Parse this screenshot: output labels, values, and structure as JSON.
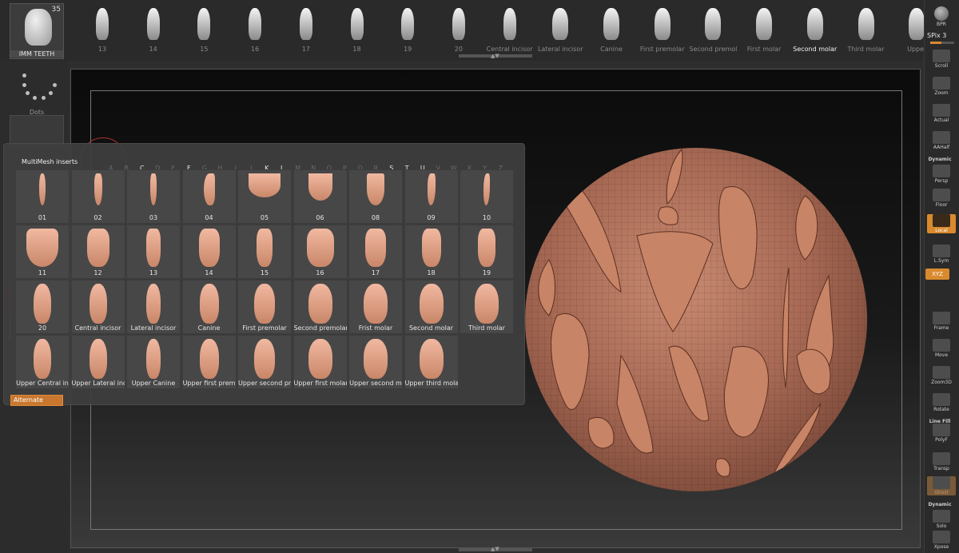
{
  "top_shelf": {
    "active_tile": {
      "label": "IMM TEETH",
      "count": "35"
    },
    "items": [
      {
        "label": "13"
      },
      {
        "label": "14"
      },
      {
        "label": "15"
      },
      {
        "label": "16"
      },
      {
        "label": "17"
      },
      {
        "label": "18"
      },
      {
        "label": "19"
      },
      {
        "label": "20"
      },
      {
        "label": "Central incisor"
      },
      {
        "label": "Lateral incisor"
      },
      {
        "label": "Canine"
      },
      {
        "label": "First premolar"
      },
      {
        "label": "Second premolar"
      },
      {
        "label": "First molar"
      },
      {
        "label": "Second molar"
      },
      {
        "label": "Third molar"
      },
      {
        "label": "Upper"
      }
    ],
    "selected_label": "Second molar"
  },
  "left_tray": {
    "dots_label": "Dots"
  },
  "multimesh": {
    "title": "MultiMesh inserts",
    "letters": [
      "A",
      "B",
      "C",
      "D",
      "E",
      "F",
      "G",
      "H",
      "I",
      "J",
      "K",
      "L",
      "M",
      "N",
      "O",
      "P",
      "Q",
      "R",
      "S",
      "T",
      "U",
      "V",
      "W",
      "X",
      "Y",
      "Z"
    ],
    "active_letters": [
      "C",
      "F",
      "K",
      "L",
      "S",
      "T",
      "U"
    ],
    "items": [
      "01",
      "02",
      "03",
      "04",
      "05",
      "06",
      "08",
      "09",
      "10",
      "11",
      "12",
      "13",
      "14",
      "15",
      "16",
      "17",
      "18",
      "19",
      "20",
      "Central incisor",
      "Lateral incisor",
      "Canine",
      "First premolar",
      "Second premolar",
      "Frist molar",
      "Second molar",
      "Third molar",
      "Upper Central in",
      "Upper Lateral inc",
      "Upper Canine",
      "Upper first prem",
      "Upper second pr",
      "Upper first molar",
      "Upper second m",
      "Upper third mola"
    ],
    "alternate_label": "Alternate"
  },
  "right_bar": {
    "bpr": "BPR",
    "spix": "SPix 3",
    "buttons": [
      "Scroll",
      "Zoom",
      "Actual",
      "AAHalf",
      "Persp",
      "Floor",
      "Local",
      "L.Sym",
      "Frame",
      "Move",
      "Zoom3D",
      "Rotate",
      "PolyF",
      "Transp",
      "Ghost",
      "Solo",
      "Xpose"
    ],
    "dynamic_label": "Dynamic",
    "linefill_label": "Line Fill",
    "xyz_label": "XYZ",
    "dynamic2_label": "Dynamic"
  },
  "colors": {
    "accent": "#d98a2e",
    "tooth": "#e9a98c",
    "panel": "#3e3e3e"
  }
}
